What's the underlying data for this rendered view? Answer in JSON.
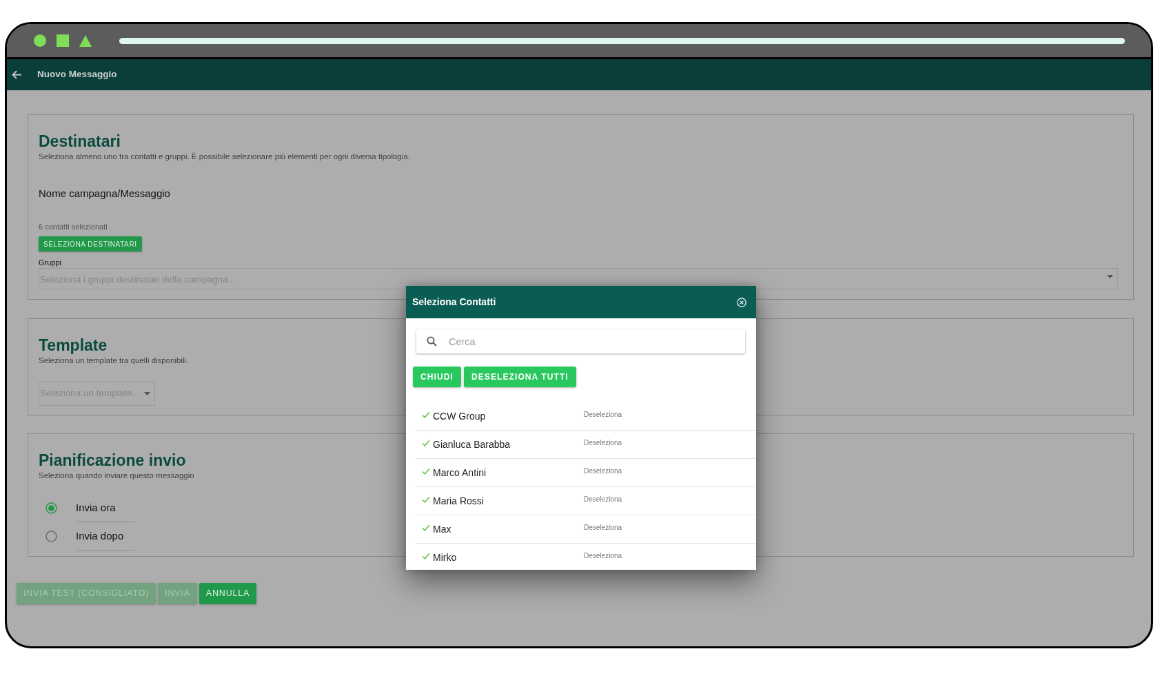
{
  "header": {
    "title": "Nuovo Messaggio"
  },
  "sections": [
    {
      "kind": "recipients",
      "title": "Destinatari",
      "subtitle": "Seleziona almeno uno tra contatti e gruppi. È possibile selezionare più elementi per ogni diversa tipologia.",
      "campaign_label": "Nome campagna/Messaggio",
      "selected_count": "6 contatti selezionati",
      "select_button": "SELEZIONA DESTINATARI",
      "groups_label": "Gruppi",
      "groups_select": {
        "placeholder": "Seleziona i gruppi destinatari della campagna..."
      }
    },
    {
      "kind": "template",
      "title": "Template",
      "subtitle": "Seleziona un template tra quelli disponibili.",
      "template_select": {
        "placeholder": "Seleziona un template..."
      }
    },
    {
      "kind": "schedule",
      "title": "Pianificazione invio",
      "subtitle": "Seleziona quando inviare questo messaggio",
      "options": [
        {
          "label": "Invia ora",
          "selected": true
        },
        {
          "label": "Invia dopo",
          "selected": false
        }
      ]
    }
  ],
  "actions": [
    {
      "label": "INVIA TEST (CONSIGLIATO)",
      "disabled": true
    },
    {
      "label": "INVIA",
      "disabled": true
    },
    {
      "label": "ANNULLA",
      "disabled": false
    }
  ],
  "modal": {
    "title": "Seleziona Contatti",
    "search": {
      "placeholder": "Cerca"
    },
    "buttons": [
      "CHIUDI",
      "DESELEZIONA TUTTI"
    ],
    "contacts": [
      {
        "name": "CCW Group",
        "selected": true,
        "action": "Deseleziona"
      },
      {
        "name": "Gianluca Barabba",
        "selected": true,
        "action": "Deseleziona"
      },
      {
        "name": "Marco Antini",
        "selected": true,
        "action": "Deseleziona"
      },
      {
        "name": "Maria Rossi",
        "selected": true,
        "action": "Deseleziona"
      },
      {
        "name": "Max",
        "selected": true,
        "action": "Deseleziona"
      },
      {
        "name": "Mirko",
        "selected": true,
        "action": "Deseleziona"
      }
    ]
  }
}
